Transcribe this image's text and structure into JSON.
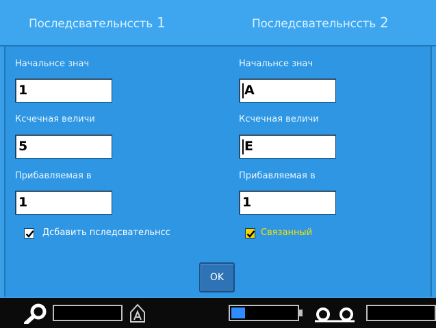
{
  "tabs": {
    "left": {
      "label": "Последсвательнсcть",
      "num": "1"
    },
    "right": {
      "label": "Последсвательнсcть",
      "num": "2"
    }
  },
  "left_column": {
    "start_label": "Начальнсе знач",
    "start_value": "1",
    "end_label": "Ксчечная величи",
    "end_value": "5",
    "increment_label": "Прибавляемая в",
    "increment_value": "1"
  },
  "right_column": {
    "start_label": "Начальнсе знач",
    "start_value": "A",
    "end_label": "Ксчечная величи",
    "end_value": "E",
    "increment_label": "Прибавляемая в",
    "increment_value": "1"
  },
  "checkboxes": {
    "add_sequence": {
      "label": "Дсбавить пследсвательнсс",
      "checked": true
    },
    "linked": {
      "label": "Связанный",
      "checked": true,
      "color": "#f4e400"
    }
  },
  "ok_button": {
    "label": "OK"
  },
  "colors": {
    "header": "#3da6ef",
    "panel": "#2e96e2",
    "status_bar": "#0b0b0b",
    "button": "#2d73b5"
  },
  "status_bar": {
    "icons": [
      "search-icon",
      "input-box",
      "unlock-icon",
      "battery-icon",
      "link-icon",
      "input-box"
    ],
    "battery_level": 0.15
  }
}
